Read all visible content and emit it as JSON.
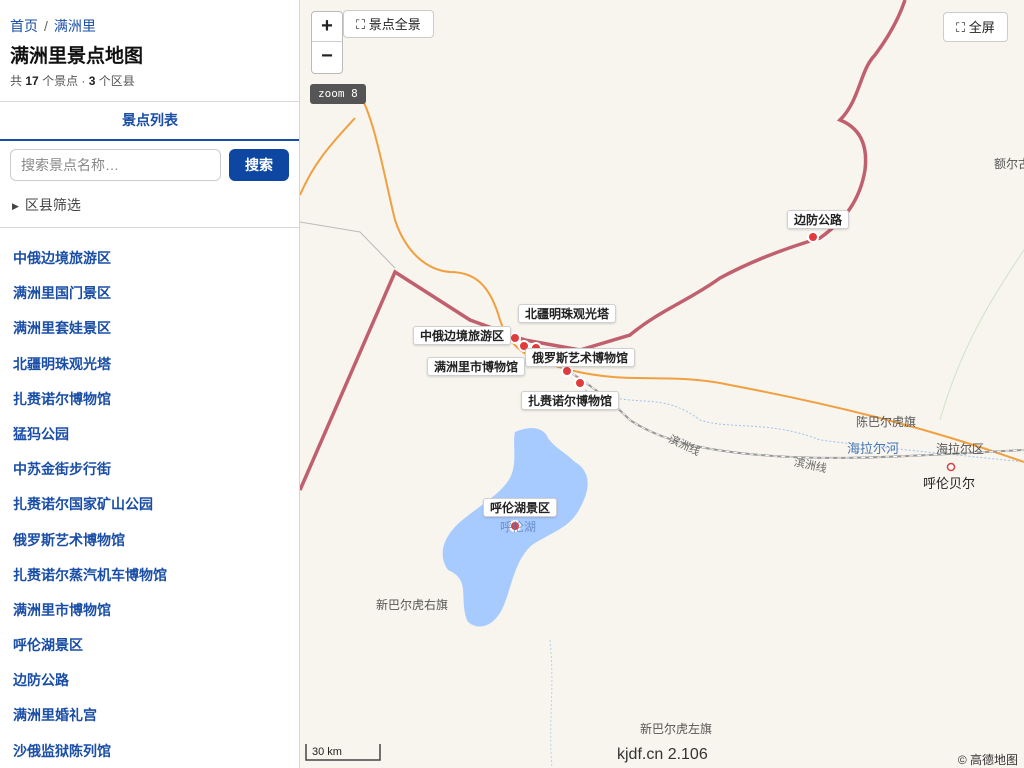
{
  "breadcrumb": {
    "home": "首页",
    "separator": "/",
    "current": "满洲里"
  },
  "page_title": "满洲里景点地图",
  "stats": {
    "prefix": "共",
    "spot_count": "17",
    "spot_suffix": "个景点 ·",
    "district_count": "3",
    "district_suffix": "个区县"
  },
  "tabs": {
    "spot_list": "景点列表"
  },
  "search": {
    "placeholder": "搜索景点名称…",
    "button_label": "搜索"
  },
  "district_filter": {
    "label": "区县筛选"
  },
  "spots": [
    "中俄边境旅游区",
    "满洲里国门景区",
    "满洲里套娃景区",
    "北疆明珠观光塔",
    "扎赉诺尔博物馆",
    "猛犸公园",
    "中苏金街步行街",
    "扎赉诺尔国家矿山公园",
    "俄罗斯艺术博物馆",
    "扎赉诺尔蒸汽机车博物馆",
    "满洲里市博物馆",
    "呼伦湖景区",
    "边防公路",
    "满洲里婚礼宫",
    "沙俄监狱陈列馆"
  ],
  "map": {
    "zoom_in": "+",
    "zoom_out": "−",
    "overview_label": "景点全景",
    "fullscreen_label": "全屏",
    "zoom_level": "zoom 8",
    "scale": "30 km",
    "version": "kjdf.cn 2.106",
    "attribution": "© 高德地图",
    "poi_labels": {
      "border_road": "边防公路",
      "pearl_tower": "北疆明珠观光塔",
      "border_tourism": "中俄边境旅游区",
      "russian_art": "俄罗斯艺术博物馆",
      "city_museum": "满洲里市博物馆",
      "zhalainuoer_museum": "扎赉诺尔博物馆",
      "hulun_lake": "呼伦湖景区"
    },
    "places": {
      "chenbaerhu": "陈巴尔虎旗",
      "hailar_district": "海拉尔区",
      "hulunbuir": "呼伦贝尔",
      "xinbaerhu_right": "新巴尔虎右旗",
      "xinbaerhu_left": "新巴尔虎左旗",
      "ergun_partial": "额尔古",
      "hailar_river": "海拉尔河",
      "lake_text": "呼伦湖",
      "rail_1": "滨洲线",
      "rail_2": "滨洲线"
    },
    "colors": {
      "border": "#c0606e",
      "road": "#f0a040",
      "lake": "#a8cbff",
      "marker": "#e03c3c"
    }
  }
}
